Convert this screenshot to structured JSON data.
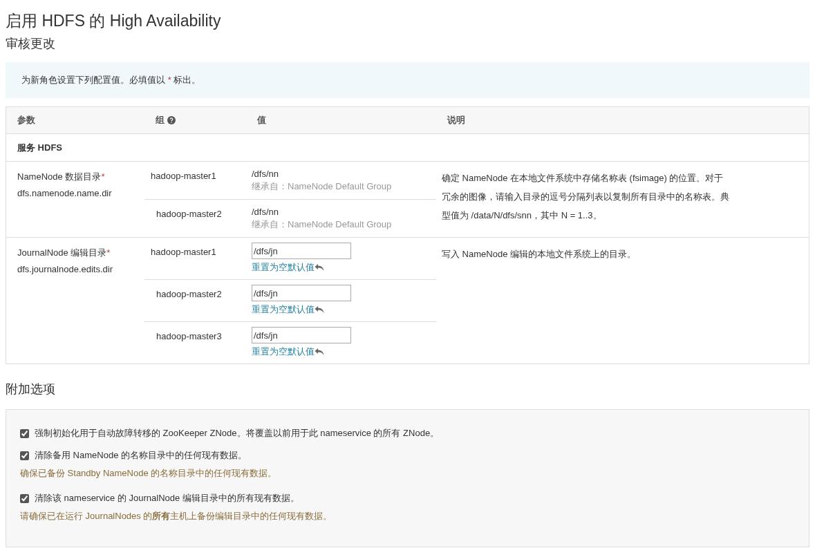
{
  "title": "启用 HDFS 的 High Availability",
  "subtitle": "审核更改",
  "info": {
    "before": "为新角色设置下列配置值。必填值以",
    "mark": "*",
    "after": "标出。"
  },
  "table": {
    "columns": [
      "参数",
      "组",
      "值",
      "说明"
    ],
    "section": "服务 HDFS",
    "rows": [
      {
        "label": "NameNode 数据目录",
        "required_mark": "*",
        "property": "dfs.namenode.name.dir",
        "description": "确定 NameNode 在本地文件系统中存储名称表 (fsimage) 的位置。对于冗余的图像，请输入目录的逗号分隔列表以复制所有目录中的名称表。典型值为 /data/N/dfs/snn，其中 N = 1..3。",
        "groups": [
          {
            "host": "hadoop-master1",
            "kind": "inherited",
            "value": "/dfs/nn",
            "note": "继承自：NameNode Default Group"
          },
          {
            "host": "hadoop-master2",
            "kind": "inherited",
            "value": "/dfs/nn",
            "note": "继承自：NameNode Default Group"
          }
        ]
      },
      {
        "label": "JournalNode 编辑目录",
        "required_mark": "*",
        "property": "dfs.journalnode.edits.dir",
        "description": "写入 NameNode 编辑的本地文件系统上的目录。",
        "groups": [
          {
            "host": "hadoop-master1",
            "kind": "editable",
            "value": "/dfs/jn",
            "note": "重置为空默认值"
          },
          {
            "host": "hadoop-master2",
            "kind": "editable",
            "value": "/dfs/jn",
            "note": "重置为空默认值"
          },
          {
            "host": "hadoop-master3",
            "kind": "editable",
            "value": "/dfs/jn",
            "note": "重置为空默认值"
          }
        ]
      }
    ]
  },
  "extra_title": "附加选项",
  "options": [
    {
      "label": "强制初始化用于自动故障转移的 ZooKeeper ZNode。将覆盖以前用于此 nameservice 的所有 ZNode。",
      "checked": true
    },
    {
      "label": "清除备用 NameNode 的名称目录中的任何现有数据。",
      "checked": true,
      "warning": "确保已备份 Standby NameNode 的名称目录中的任何现有数据。"
    },
    {
      "label": "清除该 nameservice 的 JournalNode 编辑目录中的所有现有数据。",
      "checked": true,
      "warning": "请确保已在运行 JournalNodes 的**所有**主机上备份编辑目录中的任何现有数据。"
    }
  ]
}
